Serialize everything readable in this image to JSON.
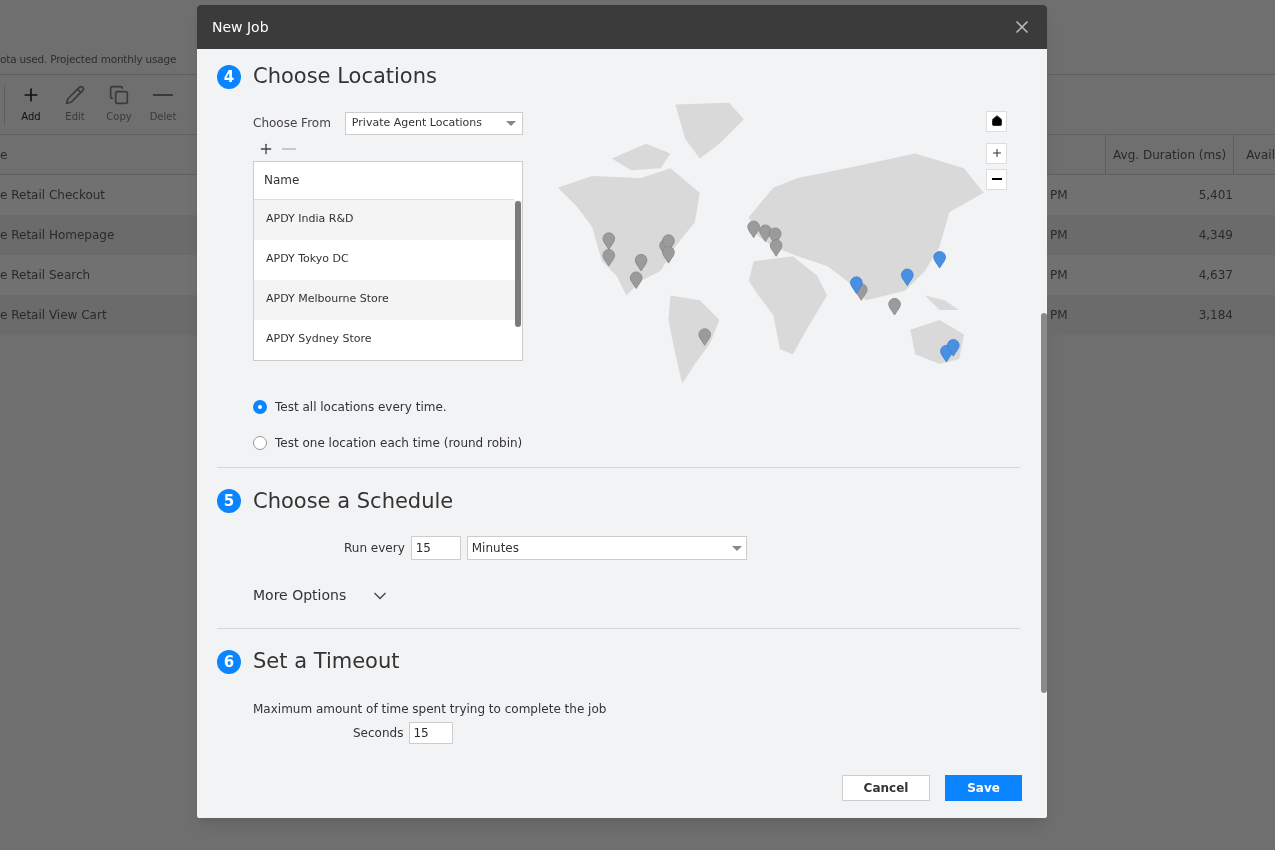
{
  "background": {
    "quota_text": "ota used. Projected monthly usage",
    "toolbar": [
      {
        "label": "Add",
        "disabled": false,
        "kind": "plus"
      },
      {
        "label": "Edit",
        "disabled": true,
        "kind": "pencil"
      },
      {
        "label": "Copy",
        "disabled": true,
        "kind": "copy"
      },
      {
        "label": "Delet",
        "disabled": true,
        "kind": "minus"
      }
    ],
    "table": {
      "left_header": "e",
      "right_headers": [
        "Avg. Duration (ms)",
        "Avail"
      ],
      "rows": [
        {
          "name": "e Retail Checkout",
          "time": "PM",
          "duration": "5,401"
        },
        {
          "name": "e Retail Homepage",
          "time": "PM",
          "duration": "4,349"
        },
        {
          "name": "e Retail Search",
          "time": "PM",
          "duration": "4,637"
        },
        {
          "name": "e Retail View Cart",
          "time": "PM",
          "duration": "3,184"
        }
      ]
    }
  },
  "dialog": {
    "title": "New Job",
    "locations": {
      "number": "4",
      "title": "Choose Locations",
      "choose_from_label": "Choose From",
      "choose_from_value": "Private Agent Locations",
      "remove_disabled": true,
      "list": {
        "column": "Name",
        "rows": [
          "APDY India R&D",
          "APDY Tokyo DC",
          "APDY Melbourne Store",
          "APDY Sydney Store"
        ]
      },
      "options": [
        {
          "label": "Test all locations every time.",
          "selected": true
        },
        {
          "label": "Test one location each time (round robin)",
          "selected": false
        }
      ]
    },
    "schedule": {
      "number": "5",
      "title": "Choose a Schedule",
      "run_every_label": "Run every",
      "run_every_value": "15",
      "unit": "Minutes",
      "more_options": "More Options",
      "expanded": false
    },
    "timeout": {
      "number": "6",
      "title": "Set a Timeout",
      "description": "Maximum amount of time spent trying to complete the job",
      "seconds_label": "Seconds",
      "seconds_value": "15"
    },
    "buttons": {
      "cancel": "Cancel",
      "save": "Save"
    }
  }
}
